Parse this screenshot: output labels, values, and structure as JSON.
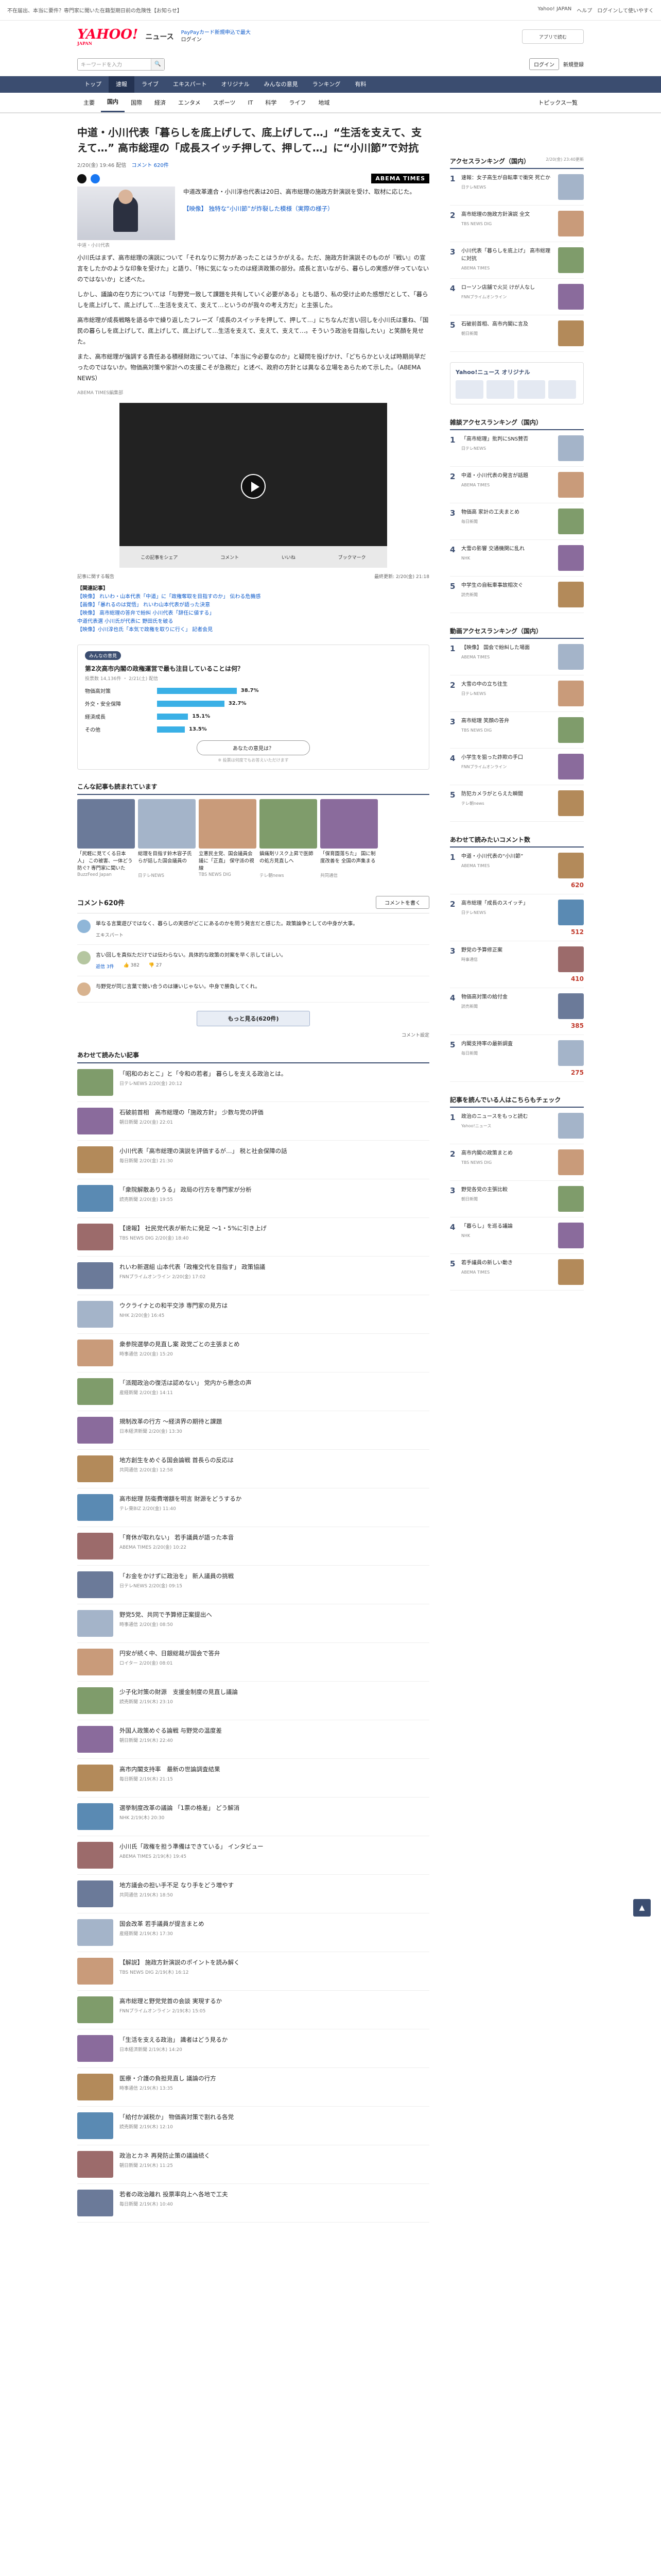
{
  "topbar": {
    "left": "不在届出、本当に要件？専門家に聞いた在籍型期日前の危険性【お知らせ】",
    "links": [
      "Yahoo! JAPAN",
      "ヘルプ"
    ],
    "login_note": "ログインして使いやすく"
  },
  "header": {
    "logo": "YAHOO!",
    "logo_sub": "JAPAN",
    "section": "ニュース",
    "note1": "PayPayカード新規申込で最大",
    "note2": "ログイン",
    "app": "アプリで読む"
  },
  "search": {
    "placeholder": "キーワードを入力",
    "login": "ログイン",
    "register": "新規登録"
  },
  "gnav": [
    "トップ",
    "速報",
    "ライブ",
    "エキスパート",
    "オリジナル",
    "みんなの意見",
    "ランキング",
    "有料"
  ],
  "subnav": [
    "主要",
    "国内",
    "国際",
    "経済",
    "エンタメ",
    "スポーツ",
    "IT",
    "科学",
    "ライフ",
    "地域"
  ],
  "subnav_right": "トピックス一覧",
  "article": {
    "title": "中道・小川代表「暮らしを底上げして、底上げして…」“生活を支えて、支えて…” 高市総理の「成長スイッチ押して、押して…」に“小川節”で対抗",
    "date": "2/20(金) 19:46 配信",
    "comments": "コメント 620件",
    "brand": "ABEMA TIMES",
    "lead": "中道改革連合・小川淳也代表は20日、高市総理の施政方針演説を受け、取材に応じた。",
    "lead_link": "【映像】 独特な“小川節”が炸裂した模様（実際の様子）",
    "caption": "中道・小川代表",
    "p1": "小川氏はまず、高市総理の演説について「それなりに努力があったことはうかがえる。ただ、施政方針演説そのものが『戦い』の宣言をしたかのような印象を受けた」と語り、「特に気になったのは経済政策の部分。成長と言いながら、暮らしの実感が伴っていないのではないか」と述べた。",
    "p2": "しかし、議論の在り方については「与野党一致して課題を共有していく必要がある」とも語り、私の受け止めた感想だとして、「暮らしを底上げして、底上げして…生活を支えて、支えて…というのが我々の考え方だ」と主張した。",
    "p3": "高市総理が成長戦略を語る中で繰り返したフレーズ「成長のスイッチを押して、押して…」にちなんだ言い回しを小川氏は重ね、「国民の暮らしを底上げして、底上げして、底上げして…生活を支えて、支えて、支えて…。そういう政治を目指したい」と笑顔を見せた。",
    "p4": "また、高市総理が強調する責任ある積極財政については、「本当に今必要なのか」と疑問を投げかけ、「どちらかといえば時期尚早だったのではないか。物価高対策や家計への支援こそが急務だ」と述べ、政府の方針とは異なる立場をあらためて示した。（ABEMA NEWS）",
    "byline": "ABEMA TIMES編集部",
    "video_bottom": [
      "この記事をシェア",
      "コメント",
      "いいね",
      "ブックマーク"
    ],
    "corrections": "記事に関する報告",
    "updated": "最終更新: 2/20(金) 21:18",
    "brand_small": "ABEMA TIMES",
    "related_head": "【関連記事】",
    "related": [
      "【映像】 れいわ・山本代表「中道」に「政権奪取を目指すのか」 伝わる危機感",
      "【画像】「暴れるのは覚悟」 れいわ山本代表が語った決意",
      "【映像】 高市総理の答弁で紛糾 小川代表「辞任に値する」",
      "中道代表選 小川氏が代表に 野田氏を破る",
      "【映像】小川淳也氏「本気で政権を取りに行く」 記者会見"
    ]
  },
  "poll": {
    "badge": "みんなの意見",
    "question": "第2次高市内閣の政権運営で最も注目していることは何？",
    "meta": "投票数 14,136件 ・ 2/21(土) 配信",
    "options": [
      {
        "label": "物価高対策",
        "value": 38.7,
        "text": "38.7%"
      },
      {
        "label": "外交・安全保障",
        "value": 32.7,
        "text": "32.7%"
      },
      {
        "label": "経済成長",
        "value": 15.1,
        "text": "15.1%"
      },
      {
        "label": "その他",
        "value": 13.5,
        "text": "13.5%"
      }
    ],
    "button": "あなたの意見は？",
    "note": "※ 投票は何度でもお答えいただけます"
  },
  "photos": {
    "head": "こんな記事も読まれています",
    "items": [
      {
        "t": "「尻軽に見てくる日本人」 この被害、一体どう防ぐ? 専門家に聞いた",
        "s": "BuzzFeed Japan"
      },
      {
        "t": "総理を目指す鈴木容子氏らが話した国会議員の",
        "s": "日テレNEWS"
      },
      {
        "t": "立憲民主党、国会議員会議に「正直」 保守派の視線",
        "s": "TBS NEWS DIG"
      },
      {
        "t": "鎮痛剤リスク上昇で医師の処方見直しへ",
        "s": "テレ朝news"
      },
      {
        "t": "「保育園落ちた」 国に制度改善を 全国の声集まる",
        "s": "共同通信"
      }
    ]
  },
  "comments": {
    "head": "コメント620件",
    "button": "コメントを書く",
    "expert": {
      "text": "単なる言葉遊びではなく、暮らしの実感がどこにあるのかを問う発言だと感じた。政策論争としての中身が大事。",
      "name": "エキスパート"
    },
    "c1": {
      "text": "言い回しを真似ただけでは伝わらない。具体的な政策の対案を早く示してほしい。",
      "replies": "返信 3件",
      "good": "382",
      "bad": "27"
    },
    "c2": {
      "text": "与野党が同じ言葉で競い合うのは嫌いじゃない。中身で勝負してくれ。"
    },
    "more": "もっと見る(620件)",
    "pref": "コメント設定"
  },
  "recommend": {
    "head": "あわせて読みたい記事",
    "items": [
      {
        "t": "「昭和のおとこ」と「令和の若者」 暮らしを支える政治とは。",
        "s": "日テレNEWS 2/20(金) 20:12"
      },
      {
        "t": "石破前首相　高市総理の「施政方針」 少数与党の評価",
        "s": "朝日新聞 2/20(金) 22:01"
      },
      {
        "t": "小川代表「高市総理の演説を評価するが…」 税と社会保障の話",
        "s": "毎日新聞 2/20(金) 21:30"
      },
      {
        "t": "「衆院解散ありうる」 政局の行方を専門家が分析",
        "s": "読売新聞 2/20(金) 19:55"
      },
      {
        "t": "【速報】 社民党代表が新たに発足 ～1・5%に引き上げ",
        "s": "TBS NEWS DIG 2/20(金) 18:40"
      },
      {
        "t": "れいわ新選組 山本代表「政権交代を目指す」 政策協議",
        "s": "FNNプライムオンライン 2/20(金) 17:02"
      },
      {
        "t": "ウクライナとの和平交渉 専門家の見方は",
        "s": "NHK 2/20(金) 16:45"
      },
      {
        "t": "衆参院選挙の見直し案 政党ごとの主張まとめ",
        "s": "時事通信 2/20(金) 15:20"
      },
      {
        "t": "「派閥政治の復活は認めない」 党内から懸念の声",
        "s": "産経新聞 2/20(金) 14:11"
      },
      {
        "t": "規制改革の行方 ～経済界の期待と課題",
        "s": "日本経済新聞 2/20(金) 13:30"
      },
      {
        "t": "地方創生をめぐる国会論戦 首長らの反応は",
        "s": "共同通信 2/20(金) 12:58"
      },
      {
        "t": "高市総理 防衛費増額を明言 財源をどうするか",
        "s": "テレ東BIZ 2/20(金) 11:40"
      },
      {
        "t": "「育休が取れない」 若手議員が語った本音",
        "s": "ABEMA TIMES 2/20(金) 10:22"
      },
      {
        "t": "「お金をかけずに政治を」 新人議員の挑戦",
        "s": "日テレNEWS 2/20(金) 09:15"
      },
      {
        "t": "野党5党、共同で予算修正案提出へ",
        "s": "時事通信 2/20(金) 08:50"
      },
      {
        "t": "円安が続く中、日銀総裁が国会で答弁",
        "s": "ロイター 2/20(金) 08:01"
      },
      {
        "t": "少子化対策の財源　支援金制度の見直し議論",
        "s": "読売新聞 2/19(木) 23:10"
      },
      {
        "t": "外国人政策めぐる論戦 与野党の温度差",
        "s": "朝日新聞 2/19(木) 22:40"
      },
      {
        "t": "高市内閣支持率　最新の世論調査結果",
        "s": "毎日新聞 2/19(木) 21:15"
      },
      {
        "t": "選挙制度改革の議論 「1票の格差」 どう解消",
        "s": "NHK 2/19(木) 20:30"
      },
      {
        "t": "小川氏「政権を担う準備はできている」 インタビュー",
        "s": "ABEMA TIMES 2/19(木) 19:45"
      },
      {
        "t": "地方議会の担い手不足 なり手をどう増やす",
        "s": "共同通信 2/19(木) 18:50"
      },
      {
        "t": "国会改革 若手議員が提言まとめ",
        "s": "産経新聞 2/19(木) 17:30"
      },
      {
        "t": "【解説】 施政方針演説のポイントを読み解く",
        "s": "TBS NEWS DIG 2/19(木) 16:12"
      },
      {
        "t": "高市総理と野党党首の会談 実現するか",
        "s": "FNNプライムオンライン 2/19(木) 15:05"
      },
      {
        "t": "「生活を支える政治」 識者はどう見るか",
        "s": "日本経済新聞 2/19(木) 14:20"
      },
      {
        "t": "医療・介護の負担見直し 議論の行方",
        "s": "時事通信 2/19(木) 13:35"
      },
      {
        "t": "「給付か減税か」 物価高対策で割れる各党",
        "s": "読売新聞 2/19(木) 12:10"
      },
      {
        "t": "政治とカネ 再発防止策の議論続く",
        "s": "朝日新聞 2/19(木) 11:25"
      },
      {
        "t": "若者の政治離れ 投票率向上へ各地で工夫",
        "s": "毎日新聞 2/19(木) 10:40"
      }
    ]
  },
  "side": {
    "access_head": "アクセスランキング（国内）",
    "access_time": "2/20(金) 23:40更新",
    "access": [
      {
        "t": "速報：女子高生が自転車で衝突 死亡か",
        "s": "日テレNEWS"
      },
      {
        "t": "高市総理の施政方針演説 全文",
        "s": "TBS NEWS DIG"
      },
      {
        "t": "小川代表「暮らしを底上げ」 高市総理に対抗",
        "s": "ABEMA TIMES"
      },
      {
        "t": "ローソン店舗で火災 けが人なし",
        "s": "FNNプライムオンライン"
      },
      {
        "t": "石破前首相、高市内閣に言及",
        "s": "朝日新聞"
      }
    ],
    "orig_title": "Yahoo!ニュース オリジナル",
    "comment_head": "雑談アクセスランキング（国内）",
    "comment_items": [
      {
        "t": "「高市総理」批判にSNS賛否",
        "s": "日テレNEWS",
        "n": ""
      },
      {
        "t": "中道・小川代表の発言が話題",
        "s": "ABEMA TIMES",
        "n": ""
      },
      {
        "t": "物価高 家計の工夫まとめ",
        "s": "毎日新聞",
        "n": ""
      },
      {
        "t": "大雪の影響 交通機関に乱れ",
        "s": "NHK",
        "n": ""
      },
      {
        "t": "中学生の自転車事故相次ぐ",
        "s": "読売新聞",
        "n": ""
      }
    ],
    "video_head": "動画アクセスランキング（国内）",
    "video_items": [
      {
        "t": "【映像】 国会で紛糾した場面",
        "s": "ABEMA TIMES"
      },
      {
        "t": "大雪の中の立ち往生",
        "s": "日テレNEWS"
      },
      {
        "t": "高市総理 笑顔の答弁",
        "s": "TBS NEWS DIG"
      },
      {
        "t": "小学生を狙った詐欺の手口",
        "s": "FNNプライムオンライン"
      },
      {
        "t": "防犯カメラがとらえた瞬間",
        "s": "テレ朝news"
      }
    ],
    "cmt_head": "あわせて読みたいコメント数",
    "cmt_items": [
      {
        "t": "中道・小川代表の“小川節”",
        "s": "ABEMA TIMES",
        "n": "620"
      },
      {
        "t": "高市総理「成長のスイッチ」",
        "s": "日テレNEWS",
        "n": "512"
      },
      {
        "t": "野党の予算修正案",
        "s": "時事通信",
        "n": "410"
      },
      {
        "t": "物価高対策の給付金",
        "s": "読売新聞",
        "n": "385"
      },
      {
        "t": "内閣支持率の最新調査",
        "s": "毎日新聞",
        "n": "275"
      }
    ],
    "rec_head": "記事を読んでいる人はこちらもチェック",
    "rec_items": [
      {
        "t": "政治のニュースをもっと読む",
        "s": "Yahoo!ニュース"
      },
      {
        "t": "高市内閣の政策まとめ",
        "s": "TBS NEWS DIG"
      },
      {
        "t": "野党各党の主張比較",
        "s": "朝日新聞"
      },
      {
        "t": "「暮らし」を巡る議論",
        "s": "NHK"
      },
      {
        "t": "若手議員の新しい動き",
        "s": "ABEMA TIMES"
      }
    ]
  },
  "colors": {
    "nav": "#3b4d70",
    "accent": "#f03",
    "bar": "#3ab0e6"
  }
}
